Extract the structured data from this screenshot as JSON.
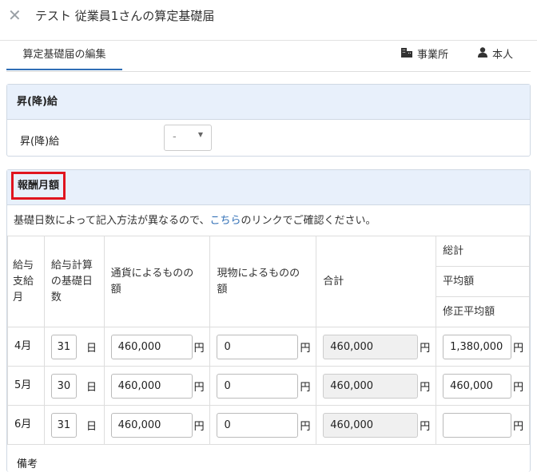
{
  "header": {
    "title": "テスト 従業員1さんの算定基礎届",
    "close_icon": "close-icon"
  },
  "tabs": {
    "active": "算定基礎届の編集",
    "office": "事業所",
    "person": "本人"
  },
  "raise_section": {
    "title": "昇(降)給",
    "field_label": "昇(降)給",
    "select_value": "-"
  },
  "remuneration": {
    "title": "報酬月額",
    "note_before": "基礎日数によって記入方法が異なるので、",
    "note_link": "こちら",
    "note_after": "のリンクでご確認ください。",
    "headers": {
      "month": "給与支給月",
      "days": "給与計算の基礎日数",
      "currency": "通貨によるものの額",
      "kind": "現物によるものの額",
      "total": "合計",
      "sum": "総計",
      "avg": "平均額",
      "adj_avg": "修正平均額"
    },
    "day_unit": "日",
    "yen": "円",
    "rows": [
      {
        "month": "4月",
        "days": "31",
        "currency": "460,000",
        "kind": "0",
        "total": "460,000",
        "extra": "1,380,000"
      },
      {
        "month": "5月",
        "days": "30",
        "currency": "460,000",
        "kind": "0",
        "total": "460,000",
        "extra": "460,000"
      },
      {
        "month": "6月",
        "days": "31",
        "currency": "460,000",
        "kind": "0",
        "total": "460,000",
        "extra": ""
      }
    ],
    "remarks_label": "備考"
  }
}
